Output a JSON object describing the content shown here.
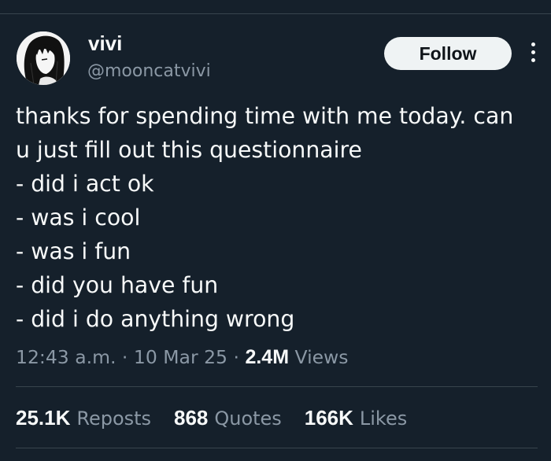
{
  "author": {
    "name": "vivi",
    "handle": "@mooncatvivi",
    "avatar_icon": "anime-girl-avatar-icon"
  },
  "actions": {
    "follow_label": "Follow",
    "more_icon": "more-vertical-icon"
  },
  "tweet": {
    "lines": [
      "thanks for spending time with me today. can",
      "u just fill out this questionnaire",
      "- did i act ok",
      "- was i cool",
      "- was i fun",
      "- did you have fun",
      "- did i do anything wrong"
    ],
    "time": "12:43 a.m.",
    "separator": "·",
    "date": "10 Mar 25",
    "views_count": "2.4M",
    "views_label": "Views"
  },
  "stats": {
    "reposts": {
      "count": "25.1K",
      "label": "Reposts"
    },
    "quotes": {
      "count": "868",
      "label": "Quotes"
    },
    "likes": {
      "count": "166K",
      "label": "Likes"
    }
  },
  "colors": {
    "background": "#15202b",
    "text": "#f7f9f9",
    "secondary_text": "#8b98a5",
    "divider": "#38444d",
    "follow_button_bg": "#eff3f4"
  }
}
